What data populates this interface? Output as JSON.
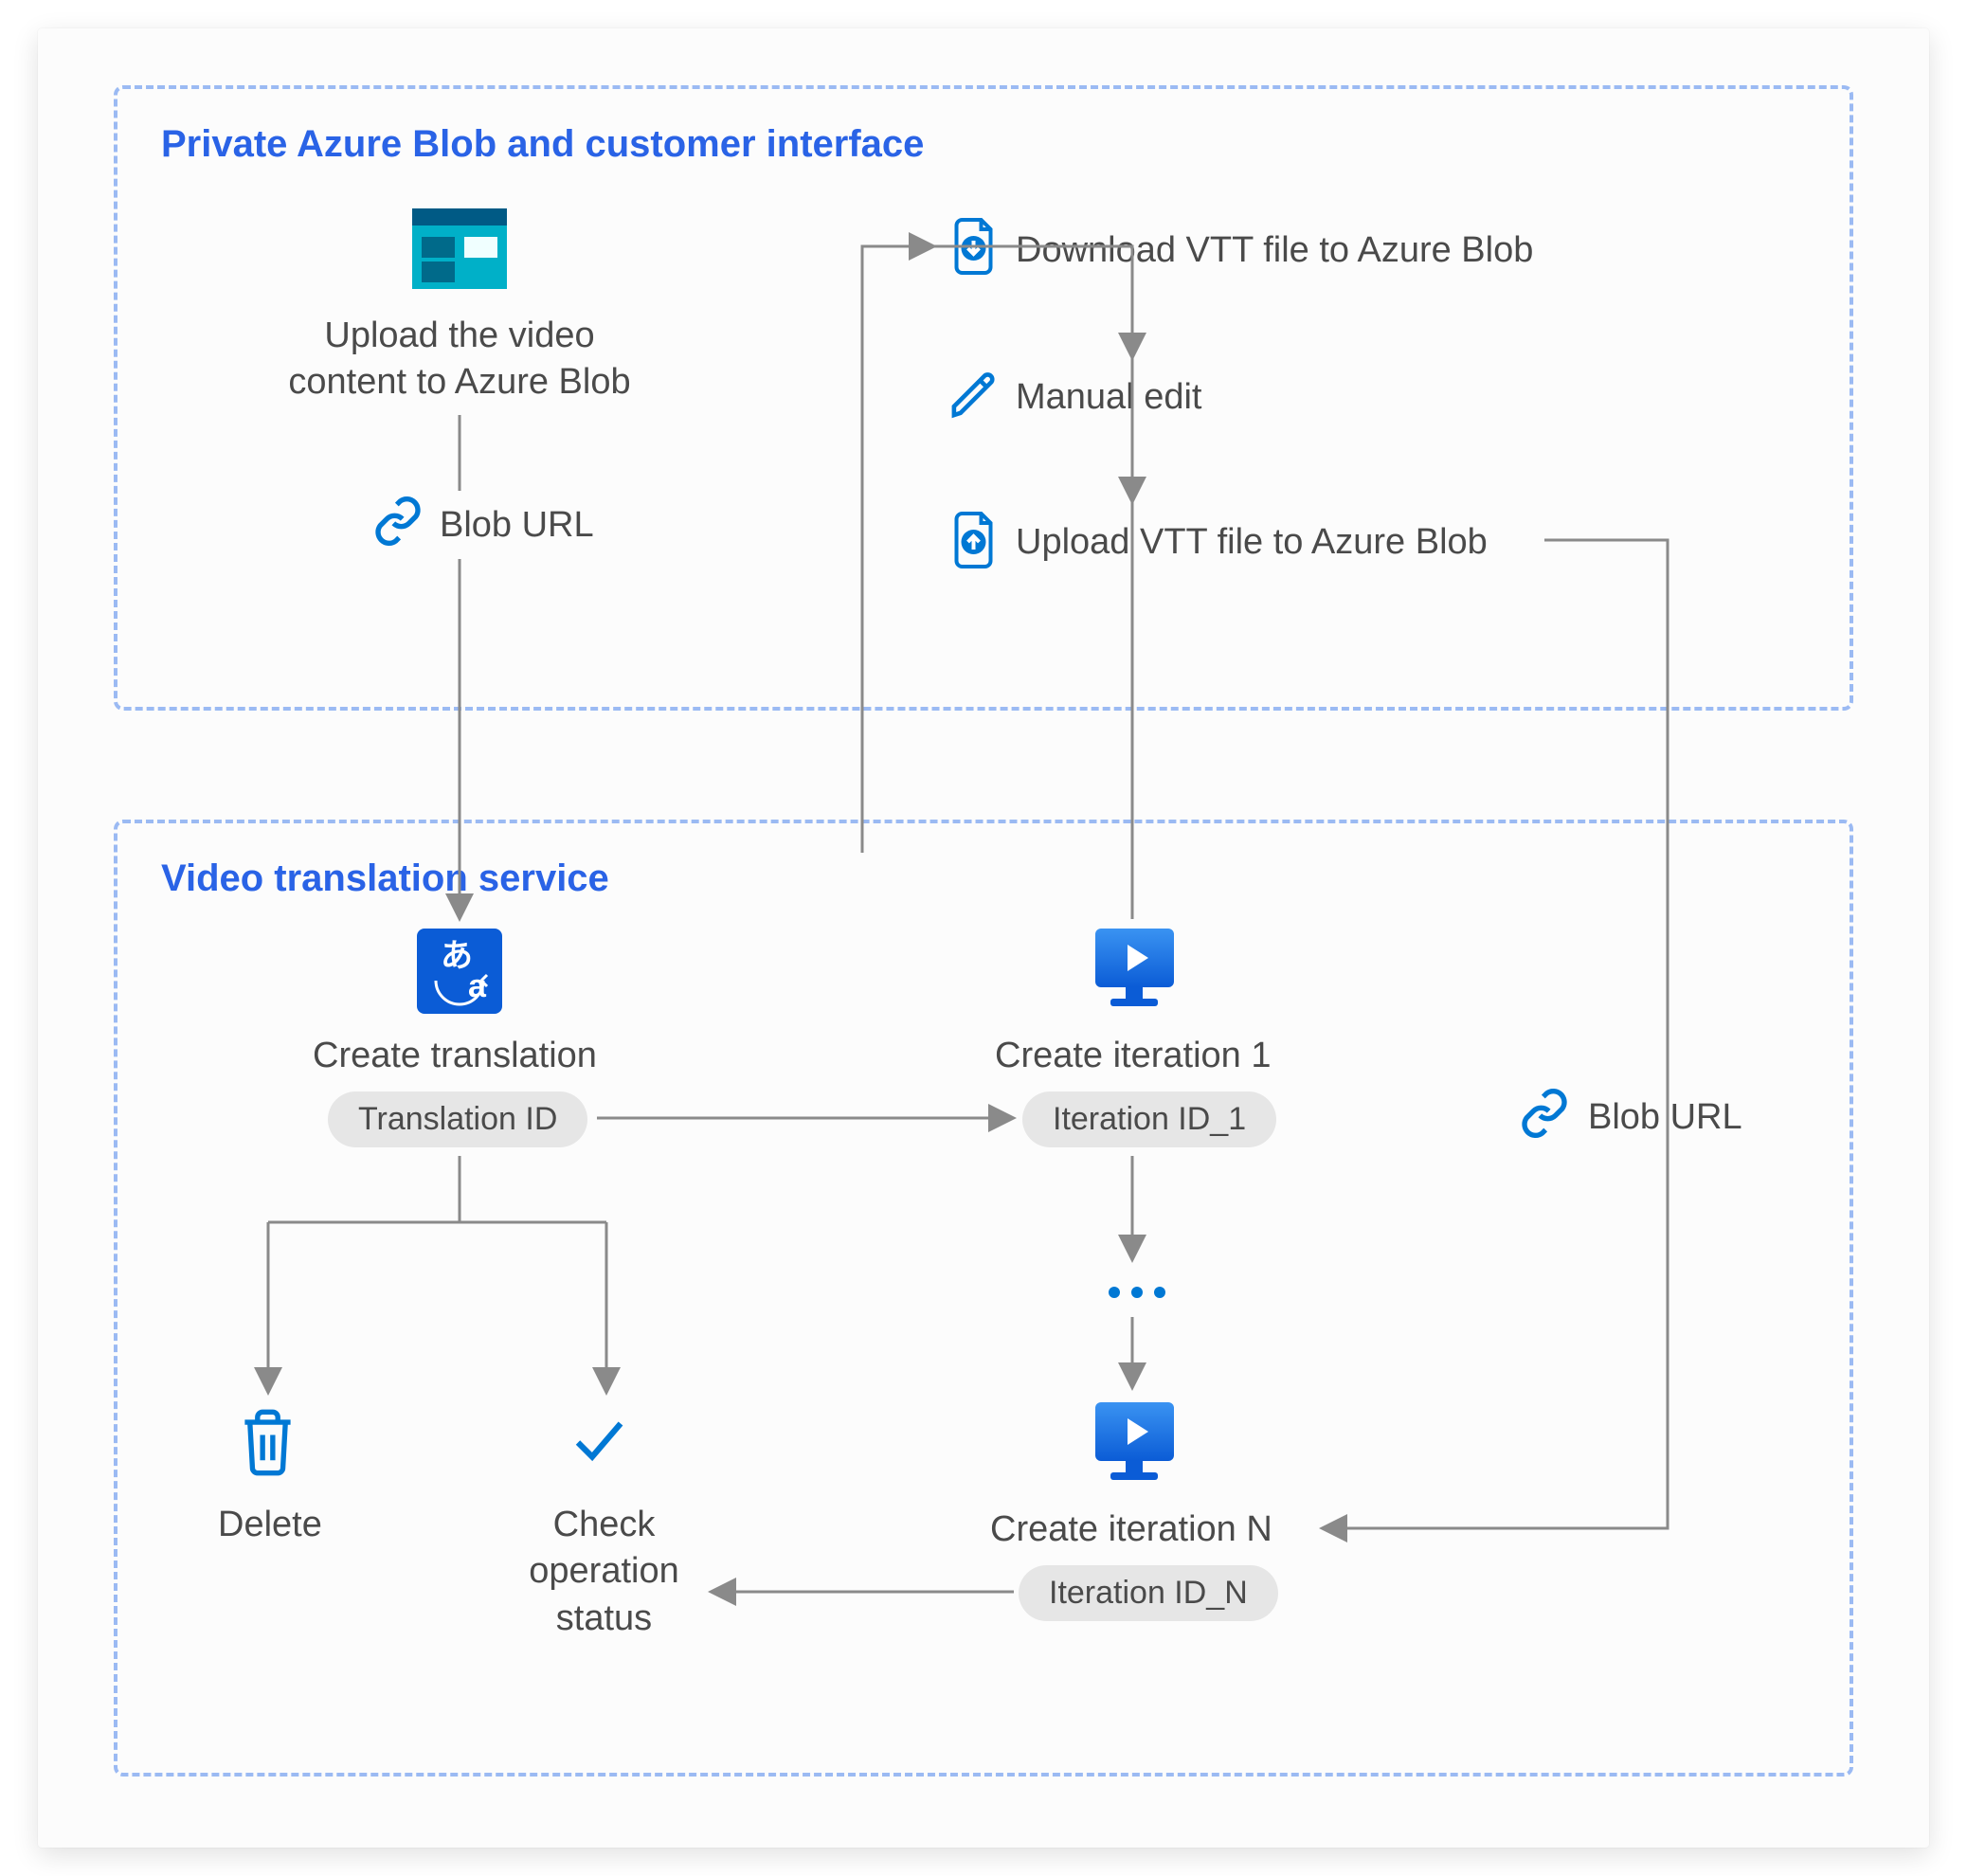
{
  "section1": {
    "title": "Private Azure Blob and customer interface"
  },
  "section2": {
    "title": "Video translation service"
  },
  "upload_video": "Upload the video content to Azure Blob",
  "blob_url_top": "Blob URL",
  "download_vtt": "Download VTT file to Azure Blob",
  "manual_edit": "Manual edit",
  "upload_vtt": "Upload VTT file to Azure Blob",
  "create_translation": "Create translation",
  "translation_id": "Translation ID",
  "create_iter1": "Create iteration 1",
  "iter_id1": "Iteration ID_1",
  "create_iterN": "Create iteration N",
  "iter_idN": "Iteration ID_N",
  "blob_url_right": "Blob URL",
  "delete": "Delete",
  "check_status": "Check operation status"
}
